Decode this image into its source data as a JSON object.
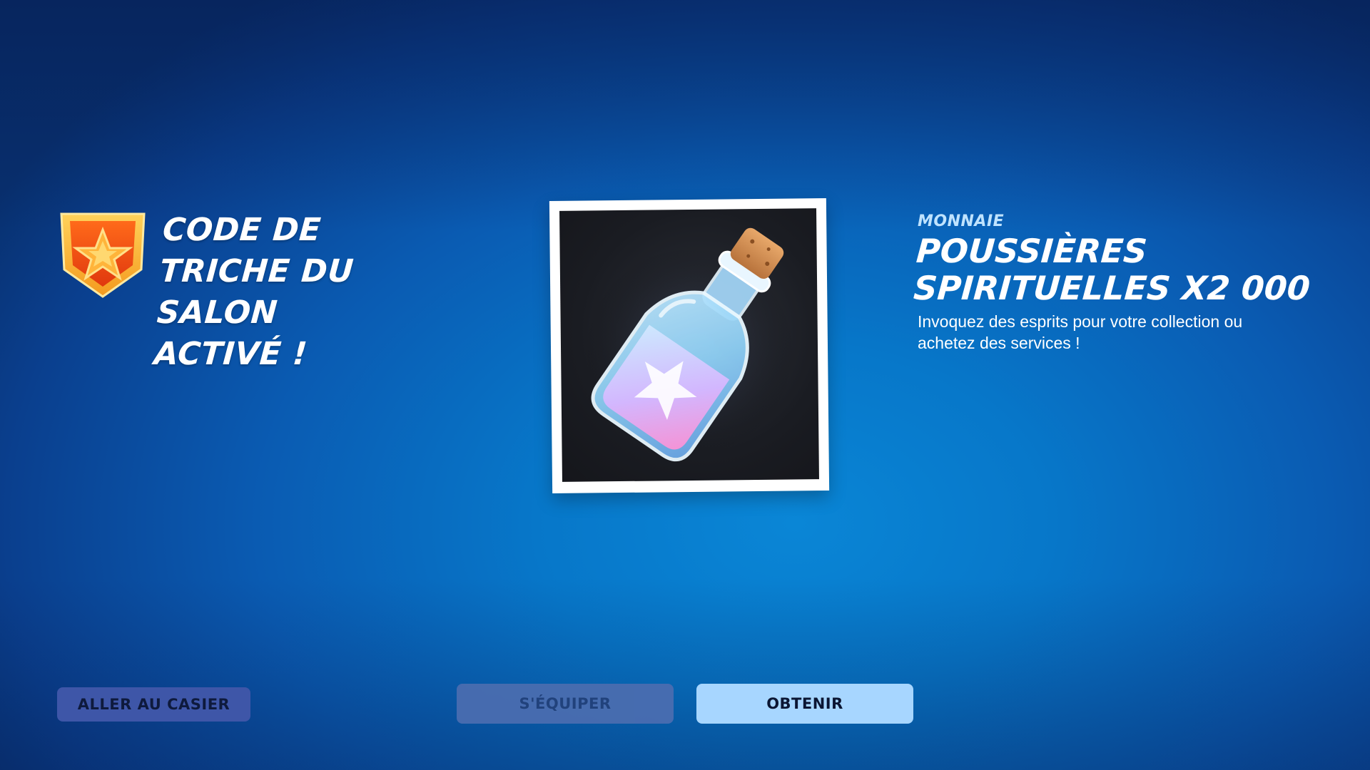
{
  "banner": {
    "title": "CODE DE TRICHE DU SALON ACTIVÉ !",
    "badge_icon": "battle-star-badge-icon"
  },
  "item": {
    "category": "MONNAIE",
    "name": "POUSSIÈRES SPIRITUELLES X2 000",
    "description": "Invoquez des esprits pour votre collection ou achetez des services !",
    "image_icon": "spirit-dust-bottle-icon"
  },
  "buttons": {
    "locker_label": "ALLER AU CASIER",
    "equip_label": "S'ÉQUIPER",
    "get_label": "OBTENIR"
  },
  "colors": {
    "background": "#0a6fc4",
    "accent_button": "#a7d6ff",
    "locker_button": "#3e56a8",
    "disabled_button": "#4a6db0"
  }
}
